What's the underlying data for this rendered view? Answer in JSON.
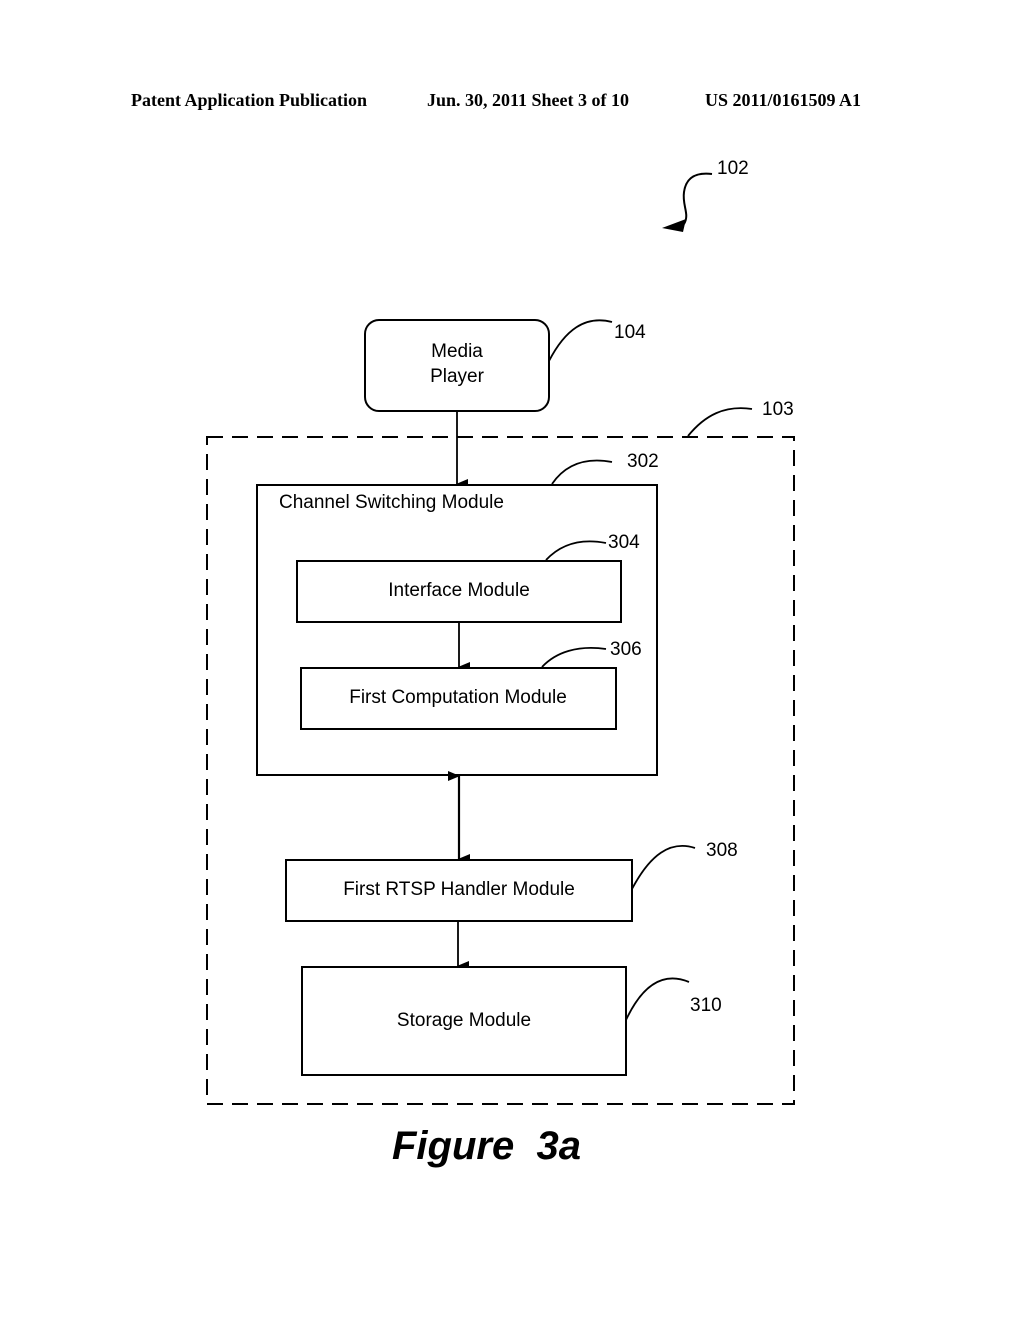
{
  "header": {
    "publication": "Patent Application Publication",
    "date_sheet": "Jun. 30, 2011  Sheet 3 of 10",
    "number": "US 2011/0161509 A1"
  },
  "diagram": {
    "refs": {
      "system": "102",
      "device": "103",
      "media_player": "104",
      "channel_switching": "302",
      "interface": "304",
      "first_computation": "306",
      "rtsp_handler": "308",
      "storage": "310"
    },
    "nodes": {
      "media_player_line1": "Media",
      "media_player_line2": "Player",
      "channel_switching": "Channel  Switching Module",
      "interface": "Interface Module",
      "first_computation": "First Computation Module",
      "rtsp_handler": "First RTSP Handler Module",
      "storage": "Storage Module"
    },
    "edges": [
      {
        "from": "Media Player",
        "to": "Channel Switching Module",
        "type": "arrow"
      },
      {
        "from": "Interface Module",
        "to": "First Computation Module",
        "type": "arrow"
      },
      {
        "from": "Channel Switching Module",
        "to": "First RTSP Handler Module",
        "type": "bidirectional"
      },
      {
        "from": "First RTSP Handler Module",
        "to": "Storage Module",
        "type": "arrow"
      }
    ]
  },
  "figure_caption": "Figure  3a"
}
